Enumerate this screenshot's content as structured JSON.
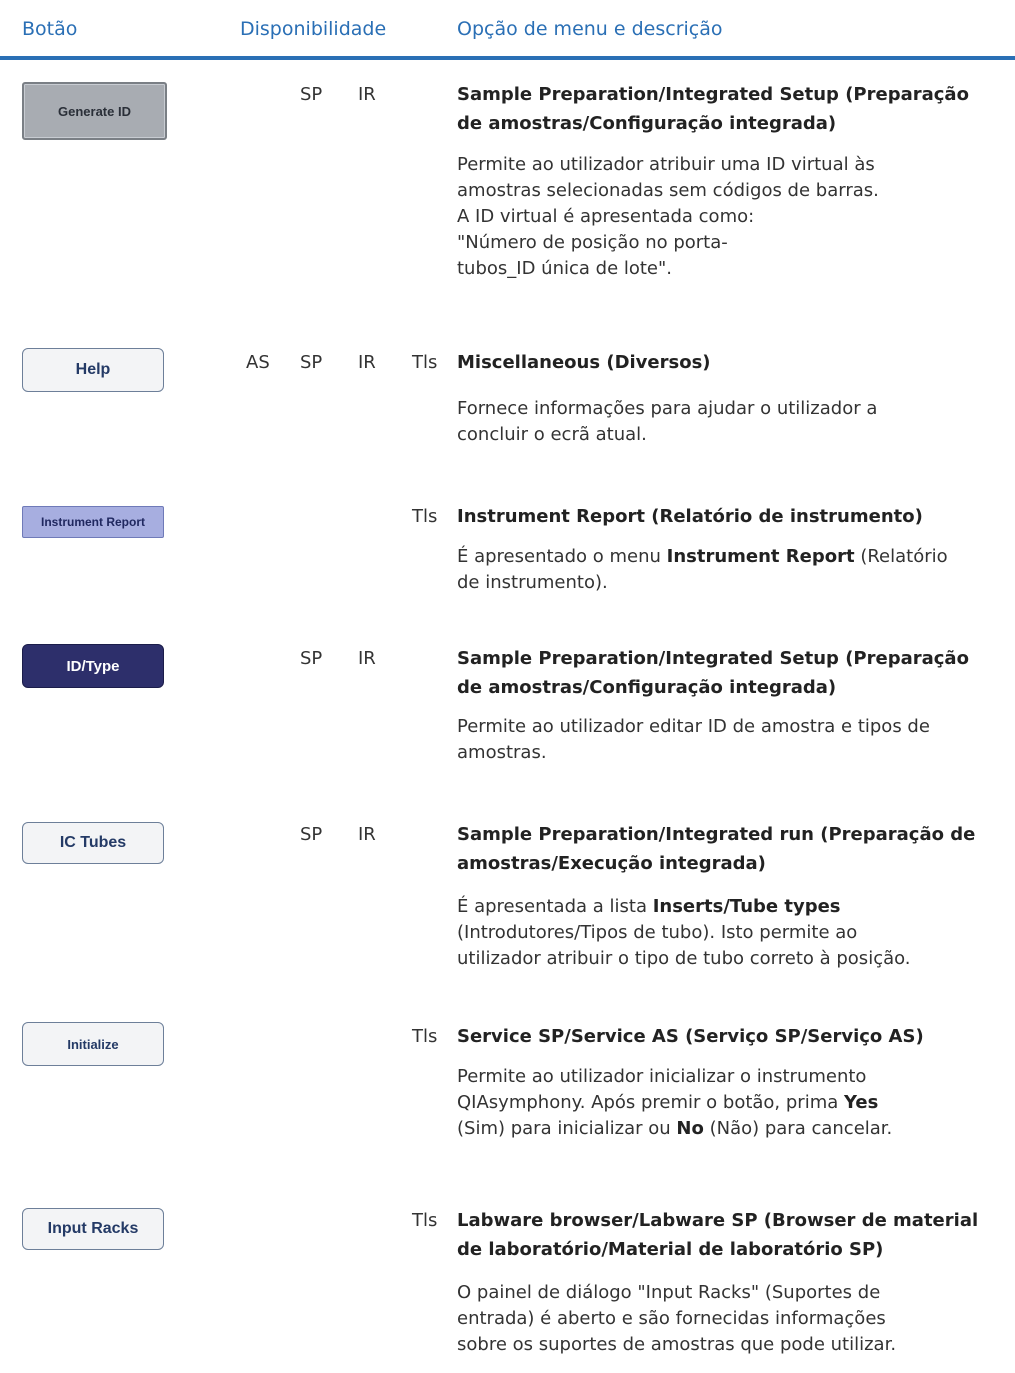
{
  "header": {
    "col_button": "Botão",
    "col_availability": "Disponibilidade",
    "col_menu": "Opção de menu e descrição"
  },
  "entries": [
    {
      "button": "Generate ID",
      "avail": {
        "as": "",
        "sp": "SP",
        "ir": "IR",
        "tls": ""
      },
      "title": "Sample Preparation/Integrated Setup (Preparação de amostras/Configuração integrada)",
      "desc": [
        "Permite ao utilizador atribuir uma ID virtual às",
        "amostras selecionadas sem códigos de barras.",
        "A ID virtual é apresentada como:",
        "\"Número de posição no porta-",
        "tubos_ID única de lote\"."
      ]
    },
    {
      "button": "Help",
      "avail": {
        "as": "AS",
        "sp": "SP",
        "ir": "IR",
        "tls": "Tls"
      },
      "title": "Miscellaneous (Diversos)",
      "desc": [
        "Fornece informações para ajudar o utilizador a",
        "concluir o ecrã atual."
      ]
    },
    {
      "button": "Instrument Report",
      "avail": {
        "as": "",
        "sp": "",
        "ir": "",
        "tls": "Tls"
      },
      "title": "Instrument Report (Relatório de instrumento)",
      "desc_parts": {
        "pre": "É apresentado o menu ",
        "bold": "Instrument Report",
        "post1": " (Relatório",
        "post2": "de instrumento)."
      }
    },
    {
      "button": "ID/Type",
      "avail": {
        "as": "",
        "sp": "SP",
        "ir": "IR",
        "tls": ""
      },
      "title": "Sample Preparation/Integrated Setup (Preparação de amostras/Configuração integrada)",
      "desc": [
        "Permite ao utilizador editar ID de amostra e tipos de",
        "amostras."
      ]
    },
    {
      "button": "IC Tubes",
      "avail": {
        "as": "",
        "sp": "SP",
        "ir": "IR",
        "tls": ""
      },
      "title": "Sample Preparation/Integrated run (Preparação de amostras/Execução integrada)",
      "desc_parts": {
        "pre": "É apresentada a lista ",
        "bold": "Inserts/Tube types",
        "line2": "(Introdutores/Tipos de tubo). Isto permite ao",
        "line3": "utilizador atribuir o tipo de tubo correto à posição."
      }
    },
    {
      "button": "Initialize",
      "avail": {
        "as": "",
        "sp": "",
        "ir": "",
        "tls": "Tls"
      },
      "title": "Service SP/Service AS (Serviço SP/Serviço AS)",
      "desc_parts": {
        "line1": "Permite ao utilizador inicializar o instrumento",
        "line2_pre": "QIAsymphony. Após premir o botão, prima ",
        "line2_bold": "Yes",
        "line3_pre": "(Sim) para inicializar ou ",
        "line3_bold": "No",
        "line3_post": " (Não) para cancelar."
      }
    },
    {
      "button": "Input Racks",
      "avail": {
        "as": "",
        "sp": "",
        "ir": "",
        "tls": "Tls"
      },
      "title": "Labware browser/Labware SP (Browser de material de laboratório/Material de laboratório SP)",
      "desc": [
        "O painel de diálogo \"Input Racks\" (Suportes de",
        "entrada) é aberto e são fornecidas informações",
        "sobre os suportes de amostras que pode utilizar."
      ]
    }
  ]
}
